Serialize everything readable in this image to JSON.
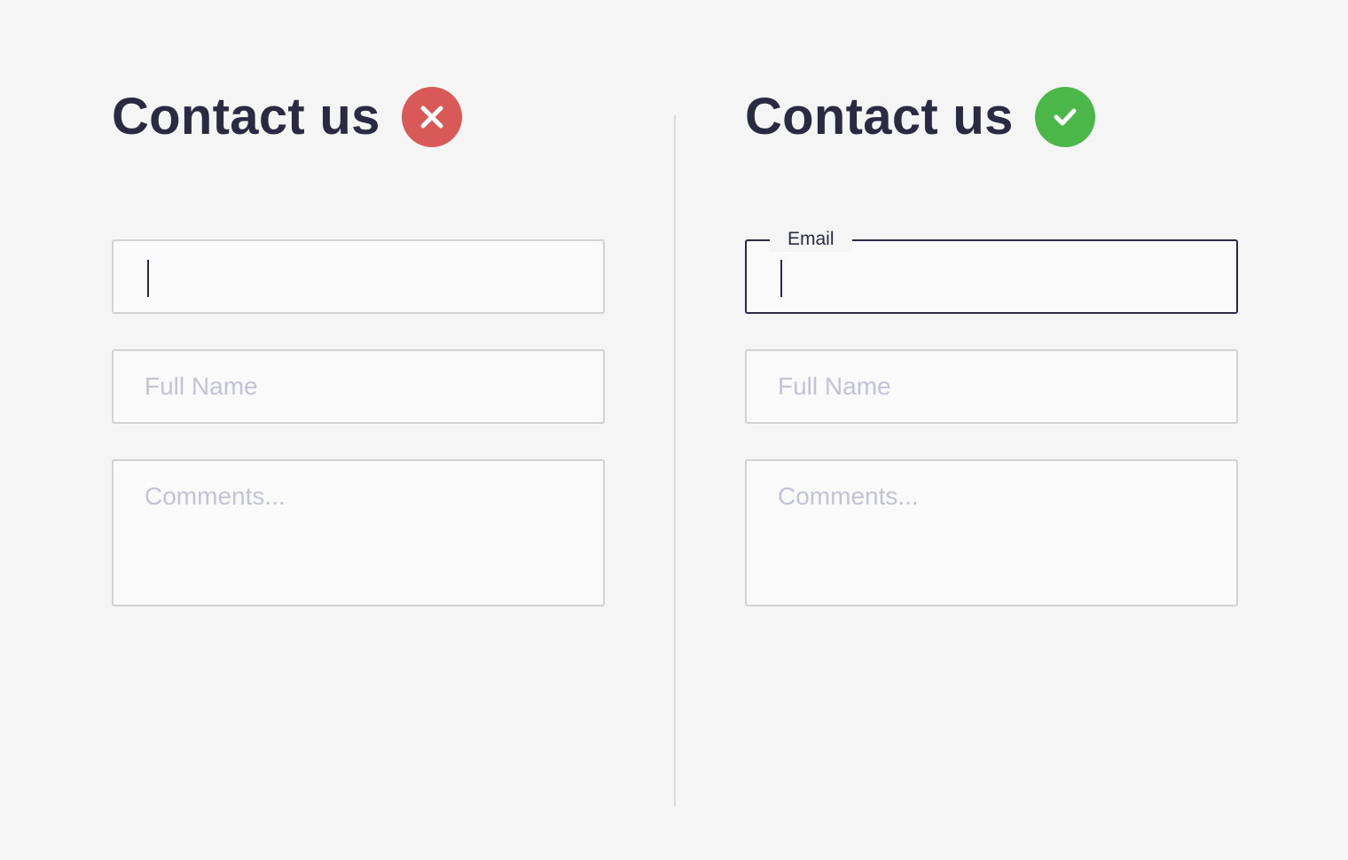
{
  "colors": {
    "background": "#f5f5f5",
    "heading_text": "#2b2a43",
    "error_red": "#d85958",
    "success_green": "#4bb748",
    "placeholder_text": "#c4c3d6",
    "field_border": "#d3d3d3",
    "focused_border": "#2b2a43"
  },
  "bad_example": {
    "heading": "Contact us",
    "status_icon": "close-icon",
    "email_field": {
      "value": "",
      "has_caret": true
    },
    "name_field": {
      "placeholder": "Full Name"
    },
    "comments_field": {
      "placeholder": "Comments..."
    }
  },
  "good_example": {
    "heading": "Contact us",
    "status_icon": "check-icon",
    "email_field": {
      "label": "Email",
      "value": "",
      "has_caret": true
    },
    "name_field": {
      "placeholder": "Full Name"
    },
    "comments_field": {
      "placeholder": "Comments..."
    }
  }
}
